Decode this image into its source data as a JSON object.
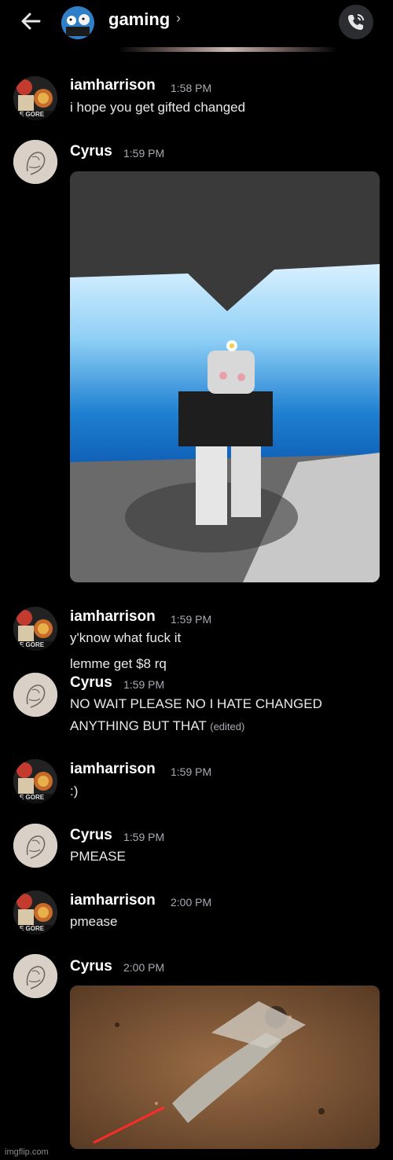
{
  "header": {
    "channel_name": "gaming",
    "chevron": "›",
    "back_icon": "arrow-left-icon",
    "call_icon": "phone-call-icon"
  },
  "messages": [
    {
      "author": "iamharrison",
      "time": "1:58 PM",
      "lines": [
        "i hope you get gifted changed"
      ]
    },
    {
      "author": "Cyrus",
      "time": "1:59 PM",
      "lines": [],
      "attachment": "image"
    },
    {
      "author": "iamharrison",
      "time": "1:59 PM",
      "lines": [
        "y'know what fuck it",
        "lemme get $8 rq"
      ]
    },
    {
      "author": "Cyrus",
      "time": "1:59 PM",
      "lines": [
        "NO WAIT PLEASE NO I HATE CHANGED",
        "ANYTHING BUT THAT"
      ],
      "edited_label": "(edited)"
    },
    {
      "author": "iamharrison",
      "time": "1:59 PM",
      "lines": [
        ":)"
      ]
    },
    {
      "author": "Cyrus",
      "time": "1:59 PM",
      "lines": [
        "PMEASE"
      ]
    },
    {
      "author": "iamharrison",
      "time": "2:00 PM",
      "lines": [
        "pmease"
      ]
    },
    {
      "author": "Cyrus",
      "time": "2:00 PM",
      "lines": [],
      "attachment": "image"
    }
  ],
  "avatar_text": {
    "harrison": "E GORE"
  },
  "watermark": "imgflip.com",
  "colors": {
    "background": "#000000",
    "username": "#ffffff",
    "timestamp": "#a8abb2",
    "call_button": "#2b2d31"
  }
}
